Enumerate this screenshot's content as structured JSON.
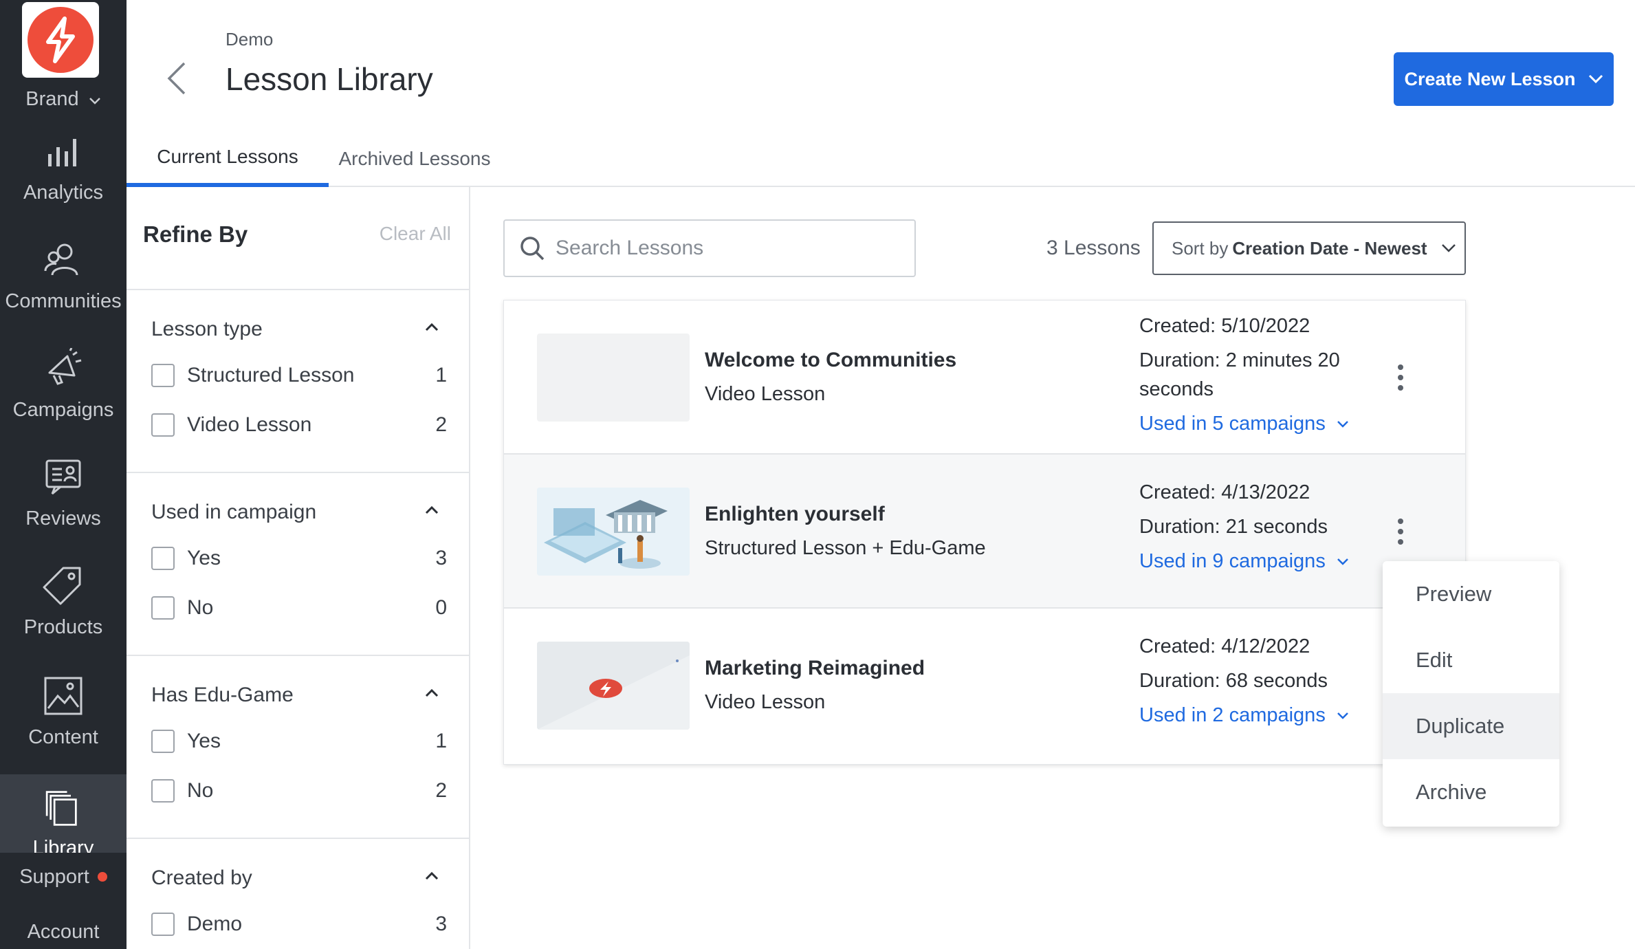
{
  "sidebar": {
    "brand": "Brand",
    "items": [
      {
        "label": "Analytics",
        "icon": "bar-chart-icon"
      },
      {
        "label": "Communities",
        "icon": "people-icon"
      },
      {
        "label": "Campaigns",
        "icon": "megaphone-icon"
      },
      {
        "label": "Reviews",
        "icon": "review-icon"
      },
      {
        "label": "Products",
        "icon": "tag-icon"
      },
      {
        "label": "Content",
        "icon": "image-icon"
      },
      {
        "label": "Library",
        "icon": "library-icon"
      }
    ],
    "support": "Support",
    "account": "Account"
  },
  "header": {
    "breadcrumb": "Demo",
    "title": "Lesson Library",
    "create_button": "Create New Lesson"
  },
  "tabs": [
    {
      "label": "Current Lessons",
      "active": true
    },
    {
      "label": "Archived Lessons",
      "active": false
    }
  ],
  "filters": {
    "title": "Refine By",
    "clear_all": "Clear All",
    "groups": [
      {
        "title": "Lesson type",
        "options": [
          {
            "label": "Structured Lesson",
            "count": "1"
          },
          {
            "label": "Video Lesson",
            "count": "2"
          }
        ]
      },
      {
        "title": "Used in campaign",
        "options": [
          {
            "label": "Yes",
            "count": "3"
          },
          {
            "label": "No",
            "count": "0"
          }
        ]
      },
      {
        "title": "Has Edu-Game",
        "options": [
          {
            "label": "Yes",
            "count": "1"
          },
          {
            "label": "No",
            "count": "2"
          }
        ]
      },
      {
        "title": "Created by",
        "options": [
          {
            "label": "Demo",
            "count": "3"
          }
        ]
      }
    ]
  },
  "search": {
    "placeholder": "Search Lessons"
  },
  "lesson_count": "3 Lessons",
  "sort": {
    "prefix": "Sort by",
    "value": "Creation Date - Newest"
  },
  "lessons": [
    {
      "name": "Welcome to Communities",
      "type": "Video Lesson",
      "created": "Created: 5/10/2022",
      "duration": "Duration: 2 minutes 20 seconds",
      "campaigns": "Used in 5 campaigns"
    },
    {
      "name": "Enlighten yourself",
      "type": "Structured Lesson + Edu-Game",
      "created": "Created: 4/13/2022",
      "duration": "Duration: 21 seconds",
      "campaigns": "Used in 9 campaigns"
    },
    {
      "name": "Marketing Reimagined",
      "type": "Video Lesson",
      "created": "Created: 4/12/2022",
      "duration": "Duration: 68 seconds",
      "campaigns": "Used in 2 campaigns"
    }
  ],
  "menu": {
    "items": [
      "Preview",
      "Edit",
      "Duplicate",
      "Archive"
    ],
    "highlighted": "Duplicate"
  },
  "colors": {
    "sidebar_bg": "#25292f",
    "accent": "#1f6ae0",
    "brand_red": "#ee4d3b"
  }
}
